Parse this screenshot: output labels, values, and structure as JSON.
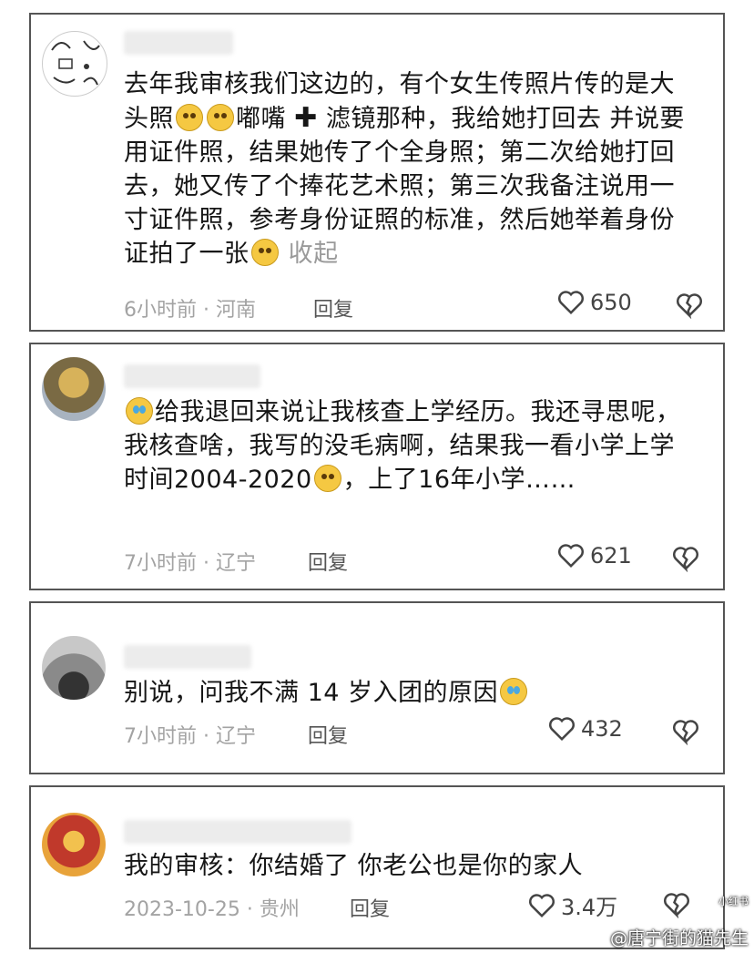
{
  "comments": [
    {
      "text_parts": [
        "去年我审核我们这边的，有个女生传照片传的是大头照",
        "嘟嘴",
        "滤镜那种，我给她打回去 并说要用证件照，结果她传了个全身照；第二次给她打回去，她又传了个捧花艺术照；第三次我备注说用一寸证件照，参考身份证照的标准，然后她举着身份证拍了一张",
        "收起"
      ],
      "meta": "6小时前 · 河南",
      "reply": "回复",
      "likes": "650"
    },
    {
      "text_parts": [
        "给我退回来说让我核查上学经历。我还寻思呢，我核查啥，我写的没毛病啊，结果我一看小学上学时间2004-2020",
        "，上了16年小学……"
      ],
      "meta": "7小时前 · 辽宁",
      "reply": "回复",
      "likes": "621"
    },
    {
      "text_parts": [
        "别说，问我不满 14 岁入团的原因"
      ],
      "meta": "7小时前 · 辽宁",
      "reply": "回复",
      "likes": "432"
    },
    {
      "text_parts": [
        "我的审核：你结婚了 你老公也是你的家人"
      ],
      "meta": "2023-10-25 · 贵州",
      "reply": "回复",
      "likes": "3.4万"
    }
  ],
  "watermark": {
    "text": "@唐宁街的猫先生",
    "small": "小红书"
  }
}
